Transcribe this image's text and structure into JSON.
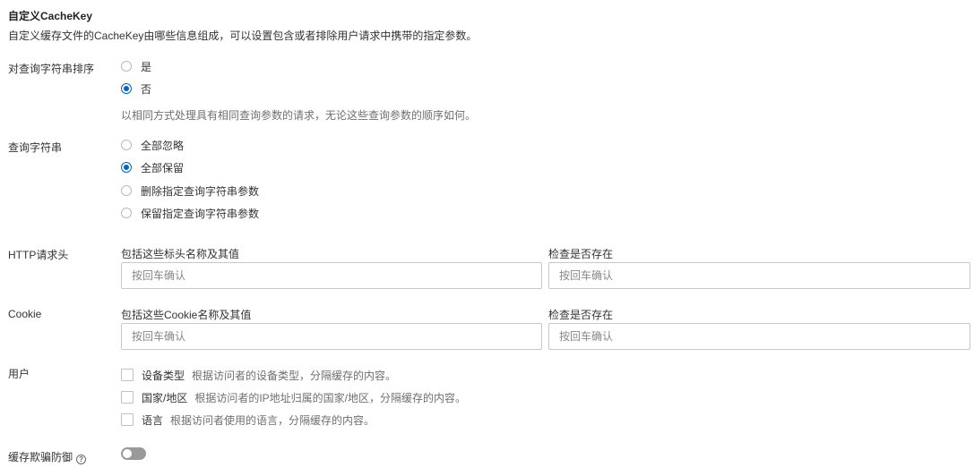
{
  "section": {
    "title": "自定义CacheKey",
    "description": "自定义缓存文件的CacheKey由哪些信息组成，可以设置包含或者排除用户请求中携带的指定参数。"
  },
  "sort_query": {
    "label": "对查询字符串排序",
    "options": [
      {
        "label": "是",
        "checked": false
      },
      {
        "label": "否",
        "checked": true
      }
    ],
    "hint": "以相同方式处理具有相同查询参数的请求，无论这些查询参数的顺序如何。"
  },
  "query_string": {
    "label": "查询字符串",
    "options": [
      {
        "label": "全部忽略",
        "checked": false
      },
      {
        "label": "全部保留",
        "checked": true
      },
      {
        "label": "删除指定查询字符串参数",
        "checked": false
      },
      {
        "label": "保留指定查询字符串参数",
        "checked": false
      }
    ]
  },
  "http_header": {
    "label": "HTTP请求头",
    "include_label": "包括这些标头名称及其值",
    "include_placeholder": "按回车确认",
    "exists_label": "检查是否存在",
    "exists_placeholder": "按回车确认"
  },
  "cookie": {
    "label": "Cookie",
    "include_label": "包括这些Cookie名称及其值",
    "include_placeholder": "按回车确认",
    "exists_label": "检查是否存在",
    "exists_placeholder": "按回车确认"
  },
  "user": {
    "label": "用户",
    "options": [
      {
        "label": "设备类型",
        "desc": "根据访问者的设备类型，分隔缓存的内容。",
        "checked": false
      },
      {
        "label": "国家/地区",
        "desc": "根据访问者的IP地址归属的国家/地区，分隔缓存的内容。",
        "checked": false
      },
      {
        "label": "语言",
        "desc": "根据访问者使用的语言，分隔缓存的内容。",
        "checked": false
      }
    ]
  },
  "cache_deception": {
    "label": "缓存欺骗防御",
    "help_icon": "question-circle-icon",
    "enabled": false
  },
  "colors": {
    "accent": "#0064c8",
    "switch_off": "#999999"
  }
}
